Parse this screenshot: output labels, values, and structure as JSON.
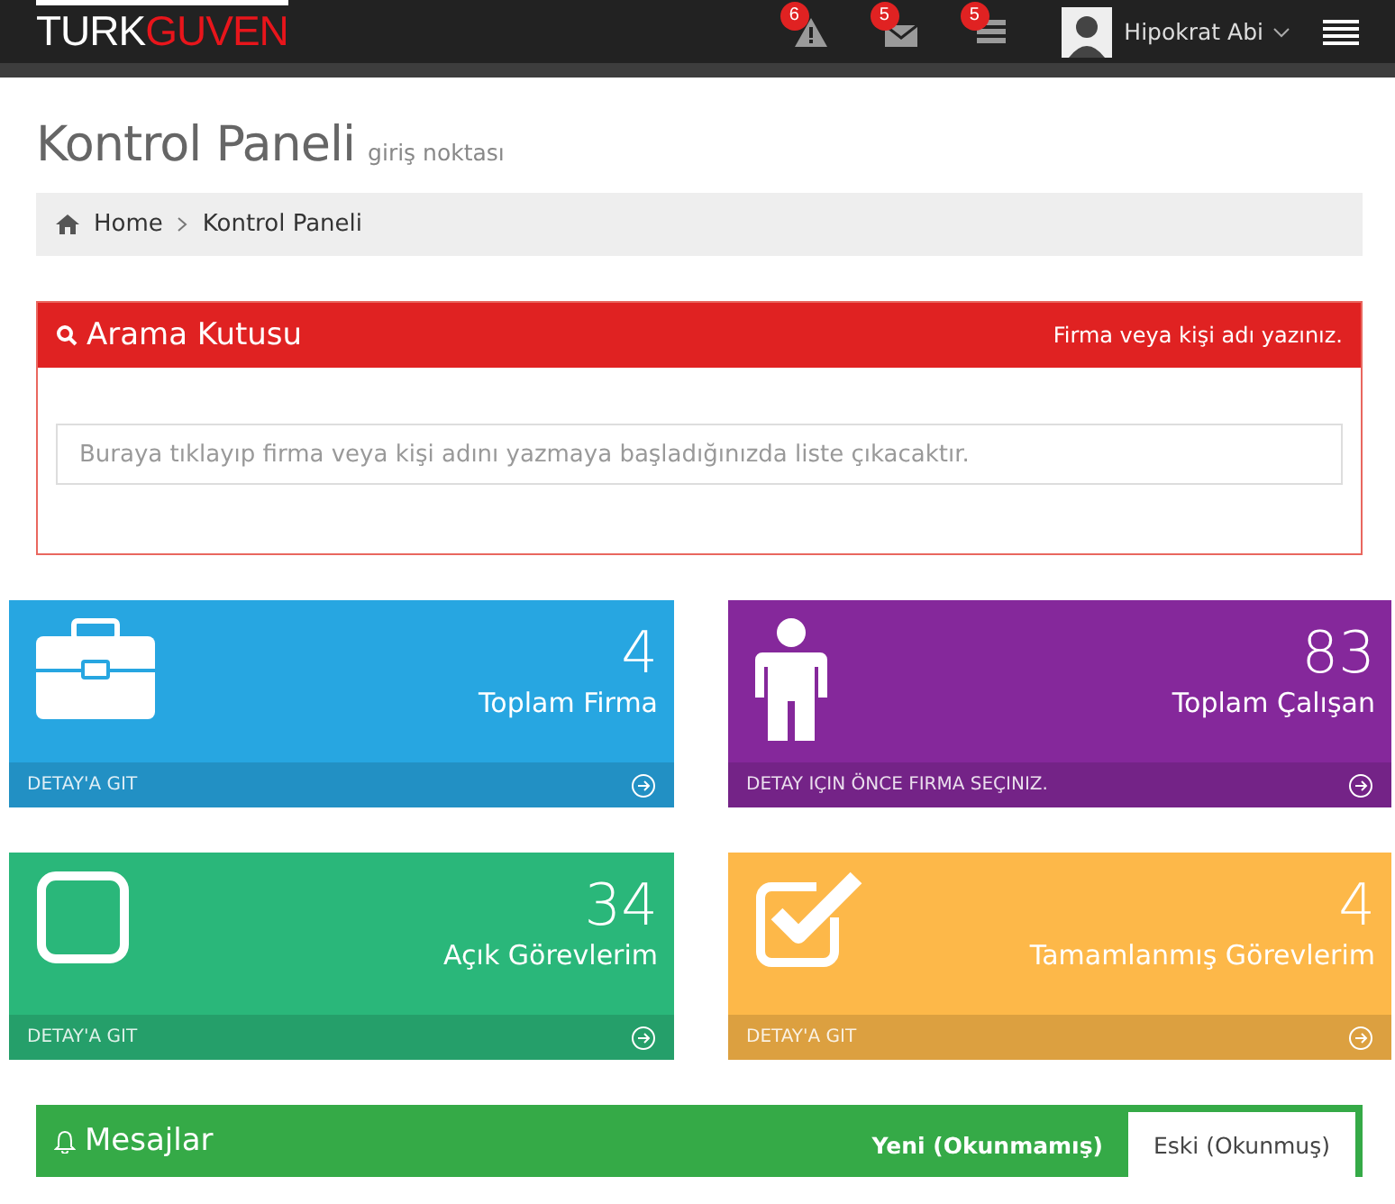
{
  "header": {
    "logo": {
      "part_1": "TURK",
      "part_2": "GUVEN"
    },
    "notifications": [
      {
        "kind": "warning",
        "count": "6"
      },
      {
        "kind": "mail",
        "count": "5"
      },
      {
        "kind": "tasks",
        "count": "5"
      }
    ],
    "user": {
      "name": "Hipokrat Abi"
    }
  },
  "page_title": {
    "title": "Kontrol Paneli",
    "subtitle": "giriş noktası"
  },
  "breadcrumb": [
    {
      "label": "Home"
    },
    {
      "label": "Kontrol Paneli"
    }
  ],
  "search_panel": {
    "title": "Arama Kutusu",
    "hint": "Firma veya kişi adı yazınız.",
    "placeholder": "Buraya tıklayıp firma veya kişi adını yazmaya başladığınızda liste çıkacaktır."
  },
  "stats": [
    {
      "kind": "briefcase",
      "color": "#27a6e1",
      "value": "4",
      "label": "Toplam Firma",
      "link": "DETAY'A GIT"
    },
    {
      "kind": "person",
      "color": "#85289b",
      "value": "83",
      "label": "Toplam Çalışan",
      "link": "DETAY IÇIN ÖNCE FIRMA SEÇINIZ."
    },
    {
      "kind": "square",
      "color": "#2ab77a",
      "value": "34",
      "label": "Açık Görevlerim",
      "link": "DETAY'A GIT"
    },
    {
      "kind": "check",
      "color": "#fdb849",
      "value": "4",
      "label": "Tamamlanmış Görevlerim",
      "link": "DETAY'A GIT"
    }
  ],
  "messages_panel": {
    "title": "Mesajlar",
    "tabs": [
      {
        "label": "Yeni (Okunmamış)",
        "selected": false
      },
      {
        "label": "Eski (Okunmuş)",
        "selected": true
      }
    ]
  }
}
